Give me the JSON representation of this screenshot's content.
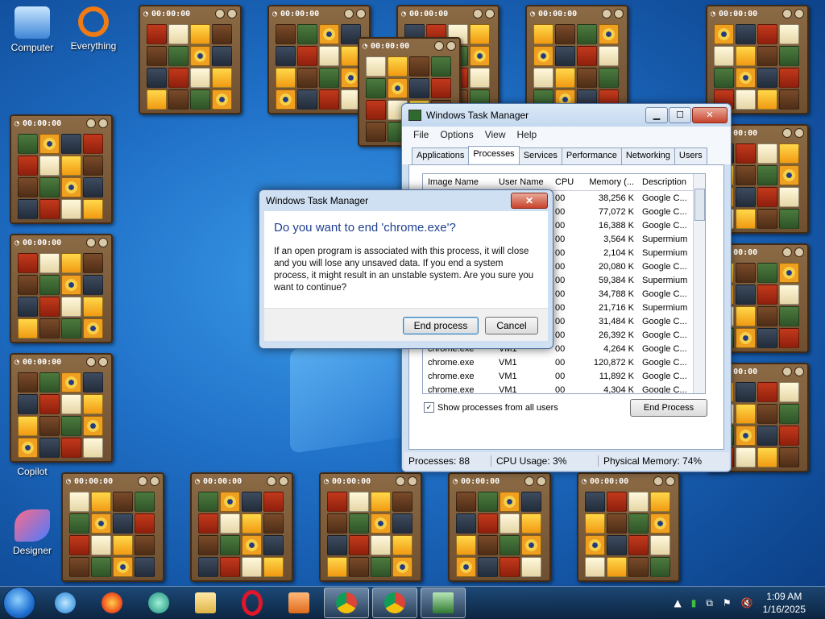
{
  "desktop": {
    "icons": [
      {
        "label": "Computer"
      },
      {
        "label": "Everything"
      },
      {
        "label": "Copilot"
      },
      {
        "label": "Designer"
      }
    ]
  },
  "gadget": {
    "timer": "00:00:00"
  },
  "task_manager": {
    "title": "Windows Task Manager",
    "menu": [
      "File",
      "Options",
      "View",
      "Help"
    ],
    "tabs": [
      "Applications",
      "Processes",
      "Services",
      "Performance",
      "Networking",
      "Users"
    ],
    "active_tab": "Processes",
    "columns": [
      "Image Name",
      "User Name",
      "CPU",
      "Memory (...",
      "Description"
    ],
    "rows": [
      {
        "name": "",
        "user": "",
        "cpu": "00",
        "mem": "38,256 K",
        "desc": "Google C..."
      },
      {
        "name": "",
        "user": "",
        "cpu": "00",
        "mem": "77,072 K",
        "desc": "Google C..."
      },
      {
        "name": "",
        "user": "",
        "cpu": "00",
        "mem": "16,388 K",
        "desc": "Google C..."
      },
      {
        "name": "",
        "user": "",
        "cpu": "00",
        "mem": "3,564 K",
        "desc": "Supermium"
      },
      {
        "name": "",
        "user": "",
        "cpu": "00",
        "mem": "2,104 K",
        "desc": "Supermium"
      },
      {
        "name": "",
        "user": "",
        "cpu": "00",
        "mem": "20,080 K",
        "desc": "Google C..."
      },
      {
        "name": "",
        "user": "",
        "cpu": "00",
        "mem": "59,384 K",
        "desc": "Supermium"
      },
      {
        "name": "",
        "user": "",
        "cpu": "00",
        "mem": "34,788 K",
        "desc": "Google C..."
      },
      {
        "name": "",
        "user": "",
        "cpu": "00",
        "mem": "21,716 K",
        "desc": "Supermium"
      },
      {
        "name": "",
        "user": "",
        "cpu": "00",
        "mem": "31,484 K",
        "desc": "Google C..."
      },
      {
        "name": "",
        "user": "",
        "cpu": "00",
        "mem": "26,392 K",
        "desc": "Google C..."
      },
      {
        "name": "chrome.exe",
        "user": "VM1",
        "cpu": "00",
        "mem": "4,264 K",
        "desc": "Google C..."
      },
      {
        "name": "chrome.exe",
        "user": "VM1",
        "cpu": "00",
        "mem": "120,872 K",
        "desc": "Google C..."
      },
      {
        "name": "chrome.exe",
        "user": "VM1",
        "cpu": "00",
        "mem": "11,892 K",
        "desc": "Google C..."
      },
      {
        "name": "chrome.exe",
        "user": "VM1",
        "cpu": "00",
        "mem": "4,304 K",
        "desc": "Google C..."
      }
    ],
    "show_all_label": "Show processes from all users",
    "show_all_checked": true,
    "end_process_label": "End Process",
    "status": {
      "processes": "Processes: 88",
      "cpu": "CPU Usage: 3%",
      "memory": "Physical Memory: 74%"
    }
  },
  "dialog": {
    "title": "Windows Task Manager",
    "heading": "Do you want to end 'chrome.exe'?",
    "body": "If an open program is associated with this process, it will close and you will lose any unsaved data. If you end a system process, it might result in an unstable system. Are you sure you want to continue?",
    "confirm_label": "End process",
    "cancel_label": "Cancel",
    "close_glyph": "✕"
  },
  "taskbar": {
    "clock_time": "1:09 AM",
    "clock_date": "1/16/2025"
  }
}
